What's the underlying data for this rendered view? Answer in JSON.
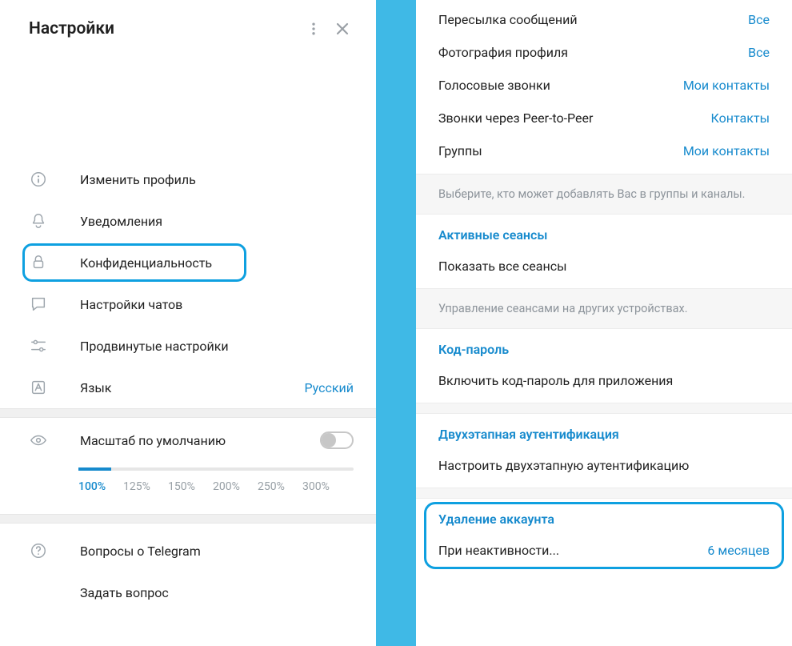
{
  "header": {
    "title": "Настройки"
  },
  "menu": {
    "items": [
      {
        "label": "Изменить профиль"
      },
      {
        "label": "Уведомления"
      },
      {
        "label": "Конфиденциальность"
      },
      {
        "label": "Настройки чатов"
      },
      {
        "label": "Продвинутые настройки"
      },
      {
        "label": "Язык",
        "value": "Русский"
      }
    ]
  },
  "scale": {
    "label": "Масштаб по умолчанию",
    "ticks": [
      "100%",
      "125%",
      "150%",
      "200%",
      "250%",
      "300%"
    ]
  },
  "help": {
    "items": [
      {
        "label": "Вопросы о Telegram"
      },
      {
        "label": "Задать вопрос"
      }
    ]
  },
  "privacy": {
    "rows": [
      {
        "label": "Пересылка сообщений",
        "value": "Все"
      },
      {
        "label": "Фотография профиля",
        "value": "Все"
      },
      {
        "label": "Голосовые звонки",
        "value": "Мои контакты"
      },
      {
        "label": "Звонки через Peer-to-Peer",
        "value": "Контакты"
      },
      {
        "label": "Группы",
        "value": "Мои контакты"
      }
    ],
    "note": "Выберите, кто может добавлять Вас в группы и каналы."
  },
  "sessions": {
    "title": "Активные сеансы",
    "action": "Показать все сеансы",
    "note": "Управление сеансами на других устройствах."
  },
  "passcode": {
    "title": "Код-пароль",
    "action": "Включить код-пароль для приложения"
  },
  "twostep": {
    "title": "Двухэтапная аутентификация",
    "action": "Настроить двухэтапную аутентификацию"
  },
  "deletion": {
    "title": "Удаление аккаунта",
    "action_label": "При неактивности...",
    "action_value": "6 месяцев"
  }
}
